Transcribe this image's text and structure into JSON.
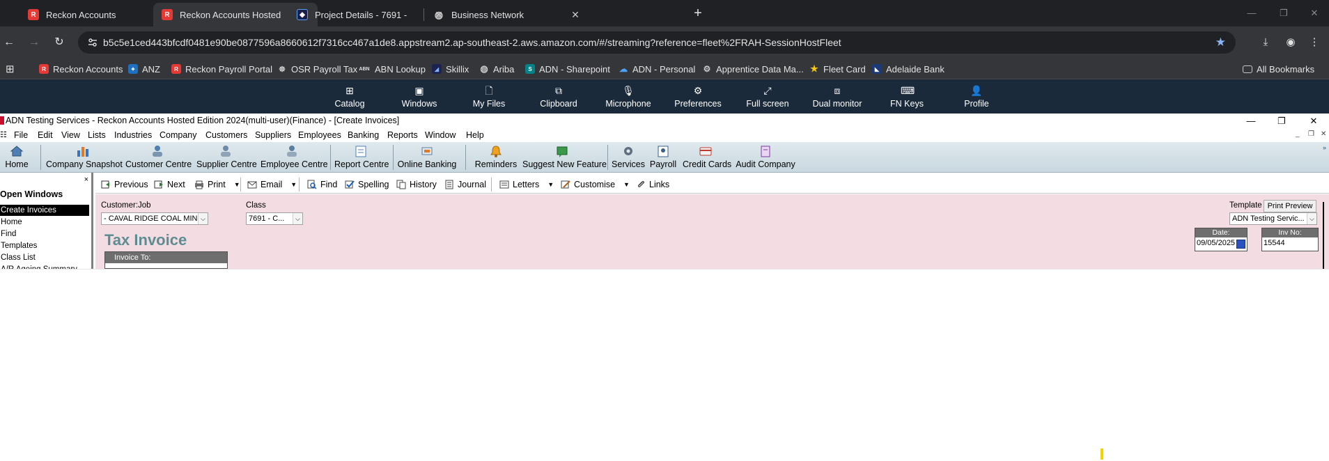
{
  "browser": {
    "tabs": [
      {
        "title": "Reckon Accounts",
        "active": false,
        "favicon": "reckon-r"
      },
      {
        "title": "Reckon Accounts Hosted",
        "active": true,
        "favicon": "reckon-r"
      },
      {
        "title": "Project Details - 7691 -",
        "active": false,
        "favicon": "project-logo"
      },
      {
        "title": "Business Network",
        "active": false,
        "favicon": "globe"
      }
    ],
    "url": "b5c5e1ced443bfcdf0481e90be0877596a8660612f7316cc467a1de8.appstream2.ap-southeast-2.aws.amazon.com/#/streaming?reference=fleet%2FRAH-SessionHostFleet",
    "bookmarks": [
      {
        "label": "Reckon Accounts",
        "icon": "reckon-r"
      },
      {
        "label": "ANZ",
        "icon": "anz"
      },
      {
        "label": "Reckon Payroll Portal",
        "icon": "reckon-r"
      },
      {
        "label": "OSR Payroll Tax",
        "icon": "osr"
      },
      {
        "label": "ABN Lookup",
        "icon": "abn"
      },
      {
        "label": "Skillix",
        "icon": "skillix"
      },
      {
        "label": "Ariba",
        "icon": "globe"
      },
      {
        "label": "ADN - Sharepoint",
        "icon": "sharepoint"
      },
      {
        "label": "ADN - Personal",
        "icon": "onedrive"
      },
      {
        "label": "Apprentice Data Ma...",
        "icon": "gear"
      },
      {
        "label": "Fleet Card",
        "icon": "star"
      },
      {
        "label": "Adelaide Bank",
        "icon": "adelaide"
      }
    ],
    "all_bookmarks": "All Bookmarks"
  },
  "appstream": {
    "buttons": [
      {
        "label": "Catalog",
        "icon": "catalog-icon"
      },
      {
        "label": "Windows",
        "icon": "windows-icon"
      },
      {
        "label": "My Files",
        "icon": "files-icon"
      },
      {
        "label": "Clipboard",
        "icon": "clipboard-icon"
      },
      {
        "label": "Microphone",
        "icon": "microphone-icon"
      },
      {
        "label": "Preferences",
        "icon": "gear-icon"
      },
      {
        "label": "Full screen",
        "icon": "fullscreen-icon"
      },
      {
        "label": "Dual monitor",
        "icon": "monitor-icon"
      },
      {
        "label": "FN Keys",
        "icon": "keyboard-icon"
      },
      {
        "label": "Profile",
        "icon": "profile-icon"
      }
    ]
  },
  "reckon": {
    "window_title": "ADN Testing Services - Reckon Accounts Hosted Edition 2024(multi-user)(Finance) - [Create Invoices]",
    "menu": [
      "File",
      "Edit",
      "View",
      "Lists",
      "Industries",
      "Company",
      "Customers",
      "Suppliers",
      "Employees",
      "Banking",
      "Reports",
      "Window",
      "Help"
    ],
    "iconbar": [
      {
        "label": "Home"
      },
      {
        "label": "Company Snapshot"
      },
      {
        "label": "Customer Centre"
      },
      {
        "label": "Supplier Centre"
      },
      {
        "label": "Employee Centre"
      },
      {
        "label": "Report Centre"
      },
      {
        "label": "Online Banking"
      },
      {
        "label": "Reminders"
      },
      {
        "label": "Suggest New Feature"
      },
      {
        "label": "Services"
      },
      {
        "label": "Payroll"
      },
      {
        "label": "Credit Cards"
      },
      {
        "label": "Audit Company"
      }
    ],
    "sidebar": {
      "close": "×",
      "heading": "Open Windows",
      "items": [
        "Create Invoices",
        "Home",
        "Find",
        "Templates",
        "Class List",
        "A/R Ageing Summary"
      ],
      "selected": "Create Invoices"
    },
    "form_toolbar": [
      {
        "label": "Previous"
      },
      {
        "label": "Next"
      },
      {
        "label": "Print"
      },
      {
        "label": "Email"
      },
      {
        "label": "Find"
      },
      {
        "label": "Spelling"
      },
      {
        "label": "History"
      },
      {
        "label": "Journal"
      },
      {
        "label": "Letters"
      },
      {
        "label": "Customise"
      },
      {
        "label": "Links"
      }
    ],
    "form": {
      "customer_job_label": "Customer:Job",
      "customer_job_value": "- CAVAL RIDGE COAL MINE",
      "class_label": "Class",
      "class_value": "7691 - C...",
      "template_label": "Template",
      "print_preview": "Print Preview",
      "template_value": "ADN Testing Servic...",
      "title": "Tax Invoice",
      "invoice_to_label": "Invoice To:",
      "date_label": "Date:",
      "date_value": "09/05/2025",
      "inv_no_label": "Inv No:",
      "inv_no_value": "15544"
    }
  }
}
